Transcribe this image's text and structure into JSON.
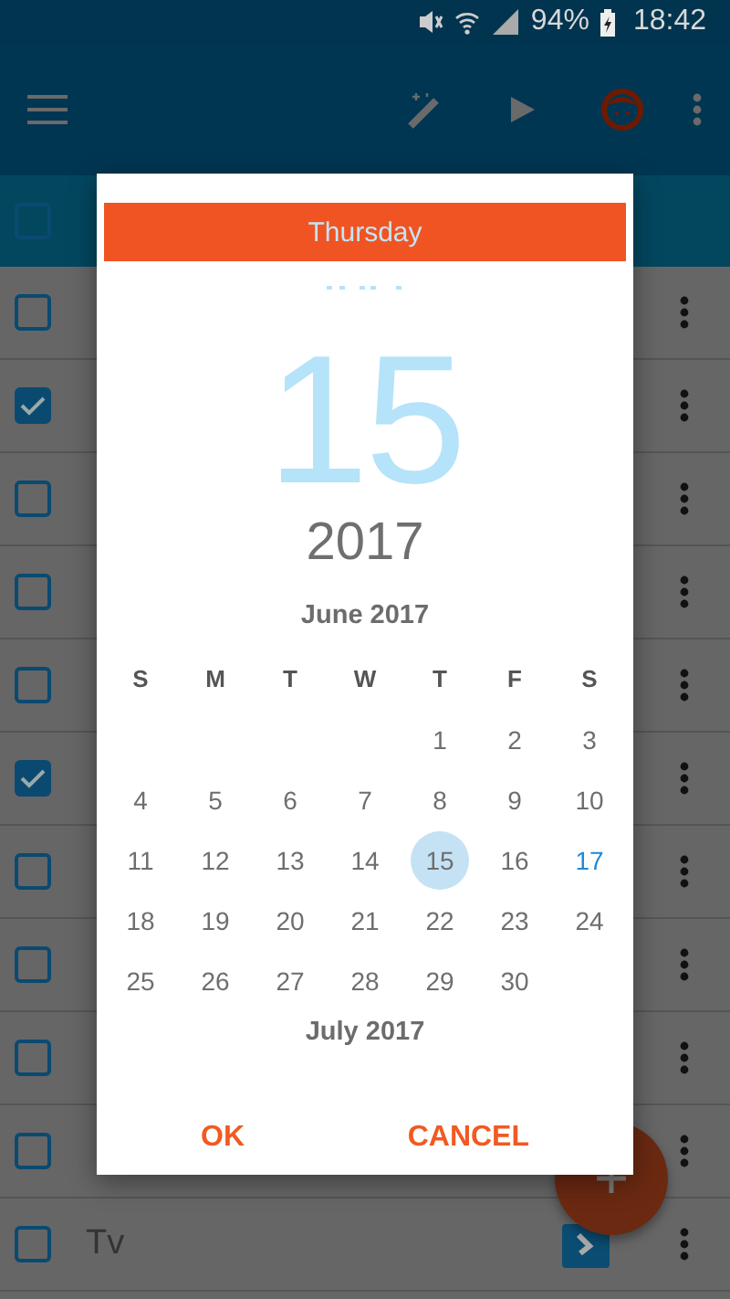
{
  "status_bar": {
    "battery": "94%",
    "time": "18:42"
  },
  "list": {
    "header": {
      "checked": false
    },
    "rows": [
      {
        "checked": false
      },
      {
        "checked": true
      },
      {
        "checked": false
      },
      {
        "checked": false
      },
      {
        "checked": false
      },
      {
        "checked": true
      },
      {
        "checked": false
      },
      {
        "checked": false
      },
      {
        "checked": false
      },
      {
        "checked": false
      },
      {
        "label": "Tv",
        "checked": false
      }
    ]
  },
  "date_dialog": {
    "weekday": "Thursday",
    "day": "15",
    "year": "2017",
    "month_title": "June 2017",
    "weekday_initials": [
      "S",
      "M",
      "T",
      "W",
      "T",
      "F",
      "S"
    ],
    "weeks": [
      [
        {
          "label": "1",
          "selected": false,
          "today": false
        },
        {
          "label": "2",
          "selected": false,
          "today": false
        },
        {
          "label": "3",
          "selected": false,
          "today": false
        }
      ],
      [
        {
          "label": "4",
          "selected": false,
          "today": false
        },
        {
          "label": "5",
          "selected": false,
          "today": false
        },
        {
          "label": "6",
          "selected": false,
          "today": false
        },
        {
          "label": "7",
          "selected": false,
          "today": false
        },
        {
          "label": "8",
          "selected": false,
          "today": false
        },
        {
          "label": "9",
          "selected": false,
          "today": false
        },
        {
          "label": "10",
          "selected": false,
          "today": false
        }
      ],
      [
        {
          "label": "11",
          "selected": false,
          "today": false
        },
        {
          "label": "12",
          "selected": false,
          "today": false
        },
        {
          "label": "13",
          "selected": false,
          "today": false
        },
        {
          "label": "14",
          "selected": false,
          "today": false
        },
        {
          "label": "15",
          "selected": true,
          "today": false
        },
        {
          "label": "16",
          "selected": false,
          "today": false
        },
        {
          "label": "17",
          "selected": false,
          "today": true
        }
      ],
      [
        {
          "label": "18",
          "selected": false,
          "today": false
        },
        {
          "label": "19",
          "selected": false,
          "today": false
        },
        {
          "label": "20",
          "selected": false,
          "today": false
        },
        {
          "label": "21",
          "selected": false,
          "today": false
        },
        {
          "label": "22",
          "selected": false,
          "today": false
        },
        {
          "label": "23",
          "selected": false,
          "today": false
        },
        {
          "label": "24",
          "selected": false,
          "today": false
        }
      ],
      [
        {
          "label": "25",
          "selected": false,
          "today": false
        },
        {
          "label": "26",
          "selected": false,
          "today": false
        },
        {
          "label": "27",
          "selected": false,
          "today": false
        },
        {
          "label": "28",
          "selected": false,
          "today": false
        },
        {
          "label": "29",
          "selected": false,
          "today": false
        },
        {
          "label": "30",
          "selected": false,
          "today": false
        }
      ]
    ],
    "next_month_title": "July 2017",
    "buttons": [
      "OK",
      "CANCEL"
    ]
  }
}
